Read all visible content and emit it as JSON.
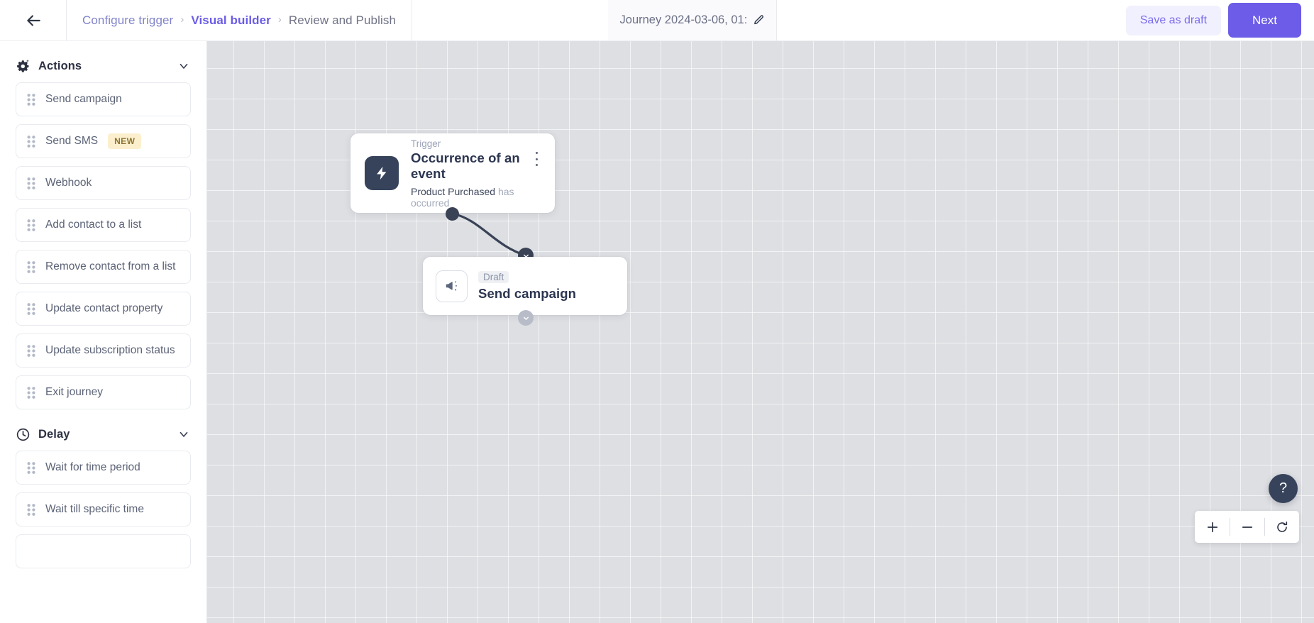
{
  "header": {
    "back_icon": "arrow-left-icon",
    "breadcrumb": [
      {
        "label": "Configure trigger",
        "state": "link"
      },
      {
        "label": "Visual builder",
        "state": "active"
      },
      {
        "label": "Review and Publish",
        "state": "plain"
      }
    ],
    "separator": "›",
    "journey_title": "Journey 2024-03-06, 01:",
    "edit_icon": "pencil-icon",
    "save_draft_label": "Save as draft",
    "next_label": "Next",
    "accent_color": "#6c5ce7",
    "draft_button_bg": "#f1f0fe"
  },
  "sidebar": {
    "groups": [
      {
        "title": "Actions",
        "icon": "gear-sparkle-icon",
        "chevron": "chevron-down-icon",
        "items": [
          {
            "label": "Send campaign",
            "badge": null
          },
          {
            "label": "Send SMS",
            "badge": "NEW"
          },
          {
            "label": "Webhook",
            "badge": null
          },
          {
            "label": "Add contact to a list",
            "badge": null
          },
          {
            "label": "Remove contact from a list",
            "badge": null
          },
          {
            "label": "Update contact property",
            "badge": null
          },
          {
            "label": "Update subscription status",
            "badge": null
          },
          {
            "label": "Exit journey",
            "badge": null
          }
        ]
      },
      {
        "title": "Delay",
        "icon": "clock-icon",
        "chevron": "chevron-down-icon",
        "items": [
          {
            "label": "Wait for time period",
            "badge": null
          },
          {
            "label": "Wait till specific time",
            "badge": null
          }
        ]
      }
    ],
    "badge_new_color": "#fcefcd"
  },
  "canvas": {
    "trigger_node": {
      "kicker": "Trigger",
      "title": "Occurrence of an event",
      "subject": "Product Purchased",
      "predicate": "has occurred",
      "icon": "lightning-bolt-icon",
      "menu_icon": "kebab-menu-icon",
      "icon_bg": "#37435a"
    },
    "campaign_node": {
      "status": "Draft",
      "title": "Send campaign",
      "icon": "megaphone-icon"
    },
    "connector": {
      "source_handle": "connection-source-dot",
      "target_chevron": "chevron-down-icon",
      "next_chevron": "chevron-down-icon",
      "stroke_color": "#3a4256"
    },
    "grid_color": "#dddfe3"
  },
  "controls": {
    "help_label": "?",
    "zoom_in_icon": "plus-icon",
    "zoom_out_icon": "minus-icon",
    "reset_icon": "reset-rotate-icon"
  }
}
